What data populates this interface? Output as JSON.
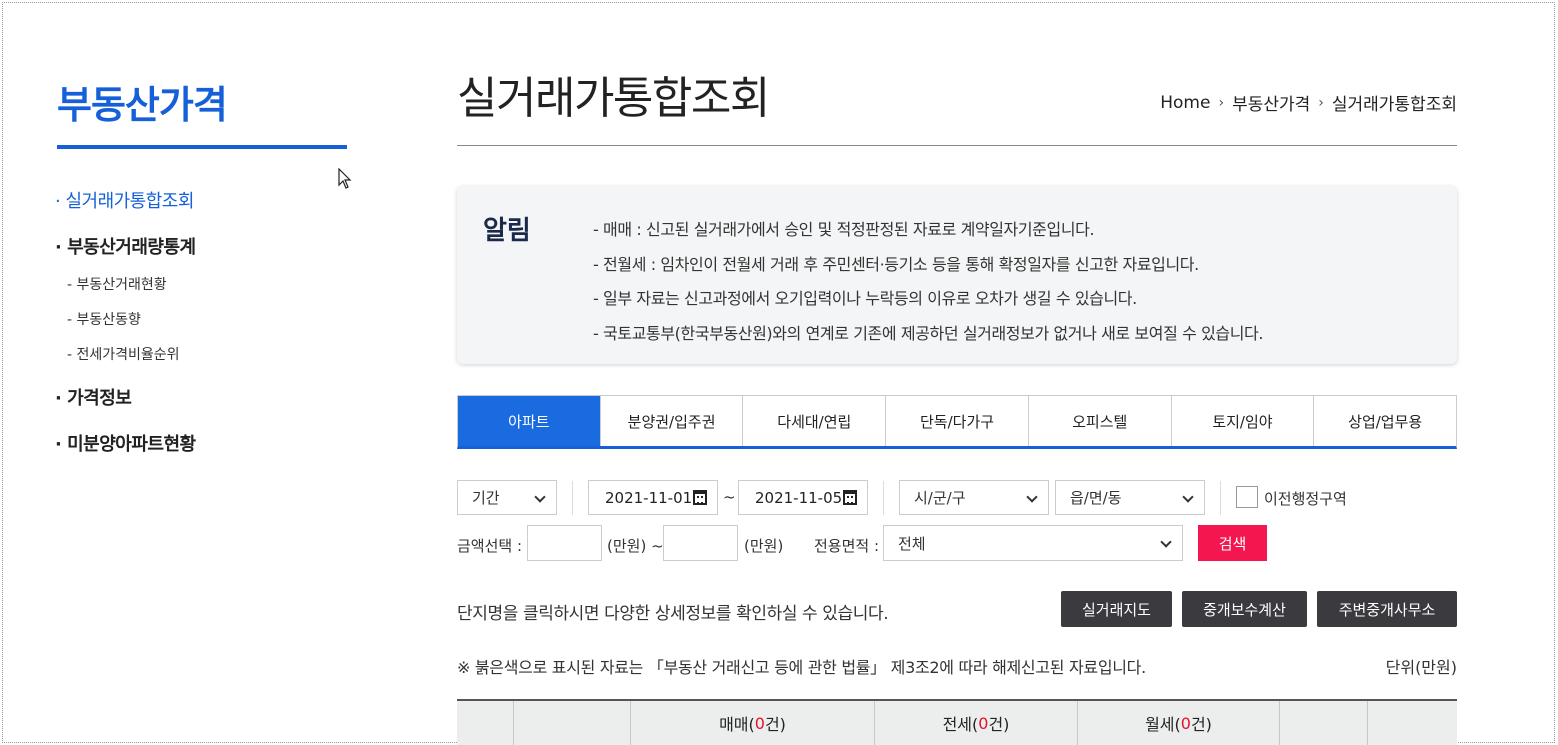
{
  "sidebar": {
    "title": "부동산가격",
    "items": [
      {
        "label": "· 실거래가통합조회"
      },
      {
        "label": "· 부동산거래량통계"
      },
      {
        "label": "- 부동산거래현황"
      },
      {
        "label": "- 부동산동향"
      },
      {
        "label": "- 전세가격비율순위"
      },
      {
        "label": "· 가격정보"
      },
      {
        "label": "· 미분양아파트현황"
      }
    ]
  },
  "header": {
    "title": "실거래가통합조회",
    "breadcrumb": [
      "Home",
      "부동산가격",
      "실거래가통합조회"
    ]
  },
  "notice": {
    "label": "알림",
    "lines": [
      "- 매매 : 신고된 실거래가에서 승인 및 적정판정된 자료로 계약일자기준입니다.",
      "- 전월세 : 임차인이 전월세 거래 후 주민센터·등기소 등을 통해 확정일자를 신고한 자료입니다.",
      "- 일부 자료는 신고과정에서 오기입력이나 누락등의 이유로 오차가 생길 수 있습니다.",
      "- 국토교통부(한국부동산원)와의 연계로 기존에 제공하던 실거래정보가 없거나 새로 보여질 수 있습니다."
    ]
  },
  "tabs": [
    "아파트",
    "분양권/입주권",
    "다세대/연립",
    "단독/다가구",
    "오피스텔",
    "토지/임야",
    "상업/업무용"
  ],
  "filters": {
    "period": "기간",
    "date_from": "2021-11-01",
    "tilde": "~",
    "date_to": "2021-11-05",
    "sigungu": "시/군/구",
    "eupmyeondong": "읍/면/동",
    "prev_district": "이전행정구역",
    "amount_label": "금액선택 :",
    "unit_from": "(만원) ~",
    "unit_to": "(만원)",
    "area_label": "전용면적 :",
    "area_value": "전체",
    "search": "검색"
  },
  "info": {
    "text": "단지명을 클릭하시면 다양한 상세정보를 확인하실 수 있습니다.",
    "buttons": [
      "실거래지도",
      "중개보수계산",
      "주변중개사무소"
    ],
    "note": "※ 붉은색으로 표시된 자료는 「부동산 거래신고 등에 관한 법률」 제3조2에 따라 해제신고된 자료입니다.",
    "unit": "단위(만원)"
  },
  "table": {
    "sale": {
      "prefix": "매매(",
      "count": "0",
      "suffix": "건)"
    },
    "jeonse": {
      "prefix": "전세(",
      "count": "0",
      "suffix": "건)"
    },
    "monthly": {
      "prefix": "월세(",
      "count": "0",
      "suffix": "건)"
    }
  }
}
